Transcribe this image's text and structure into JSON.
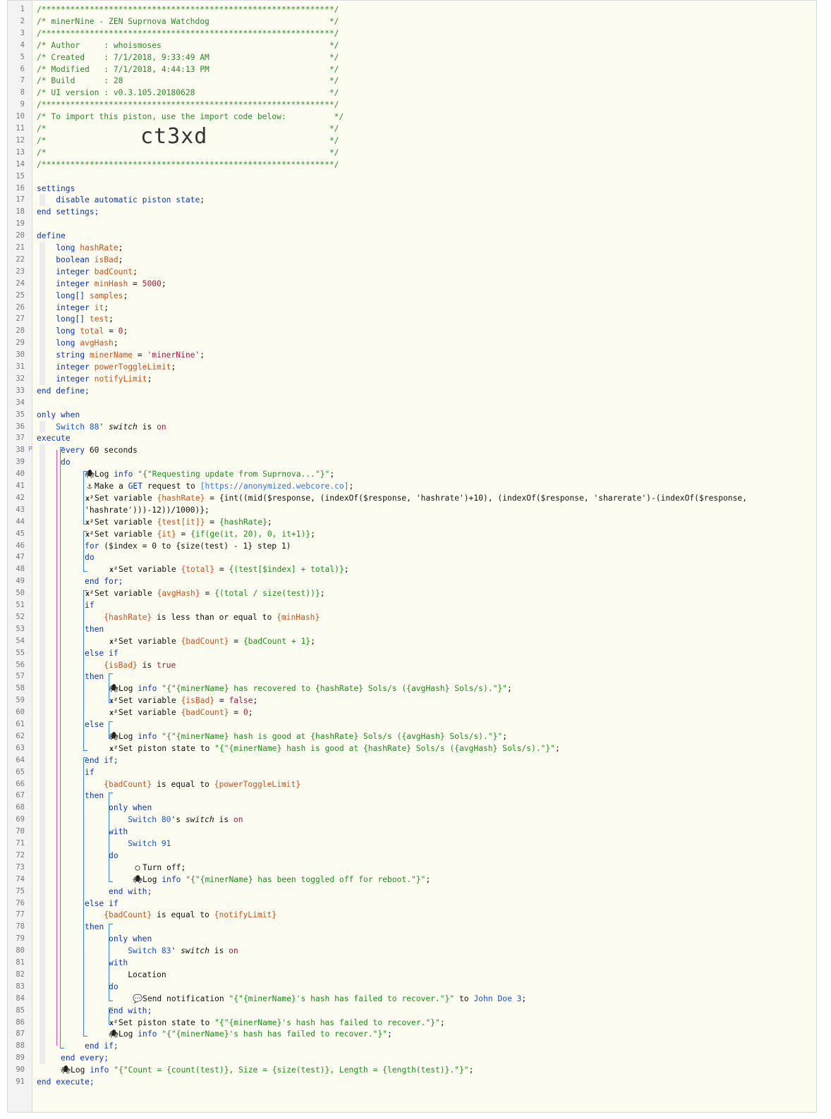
{
  "import_code": "ct3xd",
  "lines": [
    "/*************************************************************/",
    "/* minerNine - ZEN Suprnova Watchdog                         */",
    "/*************************************************************/",
    "/* Author     : whoismoses                                   */",
    "/* Created    : 7/1/2018, 9:33:49 AM                         */",
    "/* Modified   : 7/1/2018, 4:44:13 PM                         */",
    "/* Build      : 28                                           */",
    "/* UI version : v0.3.105.20180628                            */",
    "/*************************************************************/",
    "/* To import this piston, use the import code below:          */",
    "/*                                                           */",
    "/*                                                           */",
    "/*                                                           */",
    "/*************************************************************/",
    "",
    "settings",
    "    disable automatic piston state;",
    "end settings;",
    "",
    "define",
    "    long hashRate;",
    "    boolean isBad;",
    "    integer badCount;",
    "    integer minHash = 5000;",
    "    long[] samples;",
    "    integer it;",
    "    long[] test;",
    "    long total = 0;",
    "    long avgHash;",
    "    string minerName = 'minerNine';",
    "    integer powerToggleLimit;",
    "    integer notifyLimit;",
    "end define;",
    "",
    "only when",
    "    Switch 88' switch is on",
    "execute",
    "     every 60 seconds",
    "     do",
    "          Log info \"{\"Requesting update from Suprnova...\"}\";",
    "          Make a GET request to [https://anonymized.webcore.co];",
    "          Set variable {hashRate} = {int((mid($response, (indexOf($response, 'hashrate')+10), (indexOf($response, 'sharerate')-(indexOf($response,",
    "          'hashrate')))-12))/1000)};",
    "          Set variable {test[it]} = {hashRate};",
    "          Set variable {it} = {if(ge(it, 20), 0, it+1)};",
    "          for ($index = 0 to {size(test) - 1} step 1)",
    "          do",
    "               Set variable {total} = {(test[$index] + total)};",
    "          end for;",
    "          Set variable {avgHash} = {(total / size(test))};",
    "          if",
    "              {hashRate} is less than or equal to {minHash}",
    "          then",
    "               Set variable {badCount} = {badCount + 1};",
    "          else if",
    "              {isBad} is true",
    "          then",
    "               Log info \"{\"{minerName} has recovered to {hashRate} Sols/s ({avgHash} Sols/s).\"}\";",
    "               Set variable {isBad} = false;",
    "               Set variable {badCount} = 0;",
    "          else",
    "               Log info \"{\"{minerName} hash is good at {hashRate} Sols/s ({avgHash} Sols/s).\"}\";",
    "               Set piston state to \"{\"{minerName} hash is good at {hashRate} Sols/s ({avgHash} Sols/s).\"}\";",
    "          end if;",
    "          if",
    "              {badCount} is equal to {powerToggleLimit}",
    "          then",
    "               only when",
    "                   Switch 80's switch is on",
    "               with",
    "                   Switch 91",
    "               do",
    "                    Turn off;",
    "                    Log info \"{\"{minerName} has been toggled off for reboot.\"}\";",
    "               end with;",
    "          else if",
    "              {badCount} is equal to {notifyLimit}",
    "          then",
    "               only when",
    "                   Switch 83' switch is on",
    "               with",
    "                   Location",
    "               do",
    "                    Send notification \"{\"{minerName}'s hash has failed to recover.\"}\" to John Doe 3;",
    "               end with;",
    "               Set piston state to \"{\"{minerName}'s hash has failed to recover.\"}\";",
    "               Log info \"{\"{minerName}'s hash has failed to recover.\"}\";",
    "          end if;",
    "     end every;",
    "     Log info \"{\"Count = {count(test)}, Size = {size(test)}, Length = {length(test)}.\"}\";",
    "end execute;"
  ]
}
